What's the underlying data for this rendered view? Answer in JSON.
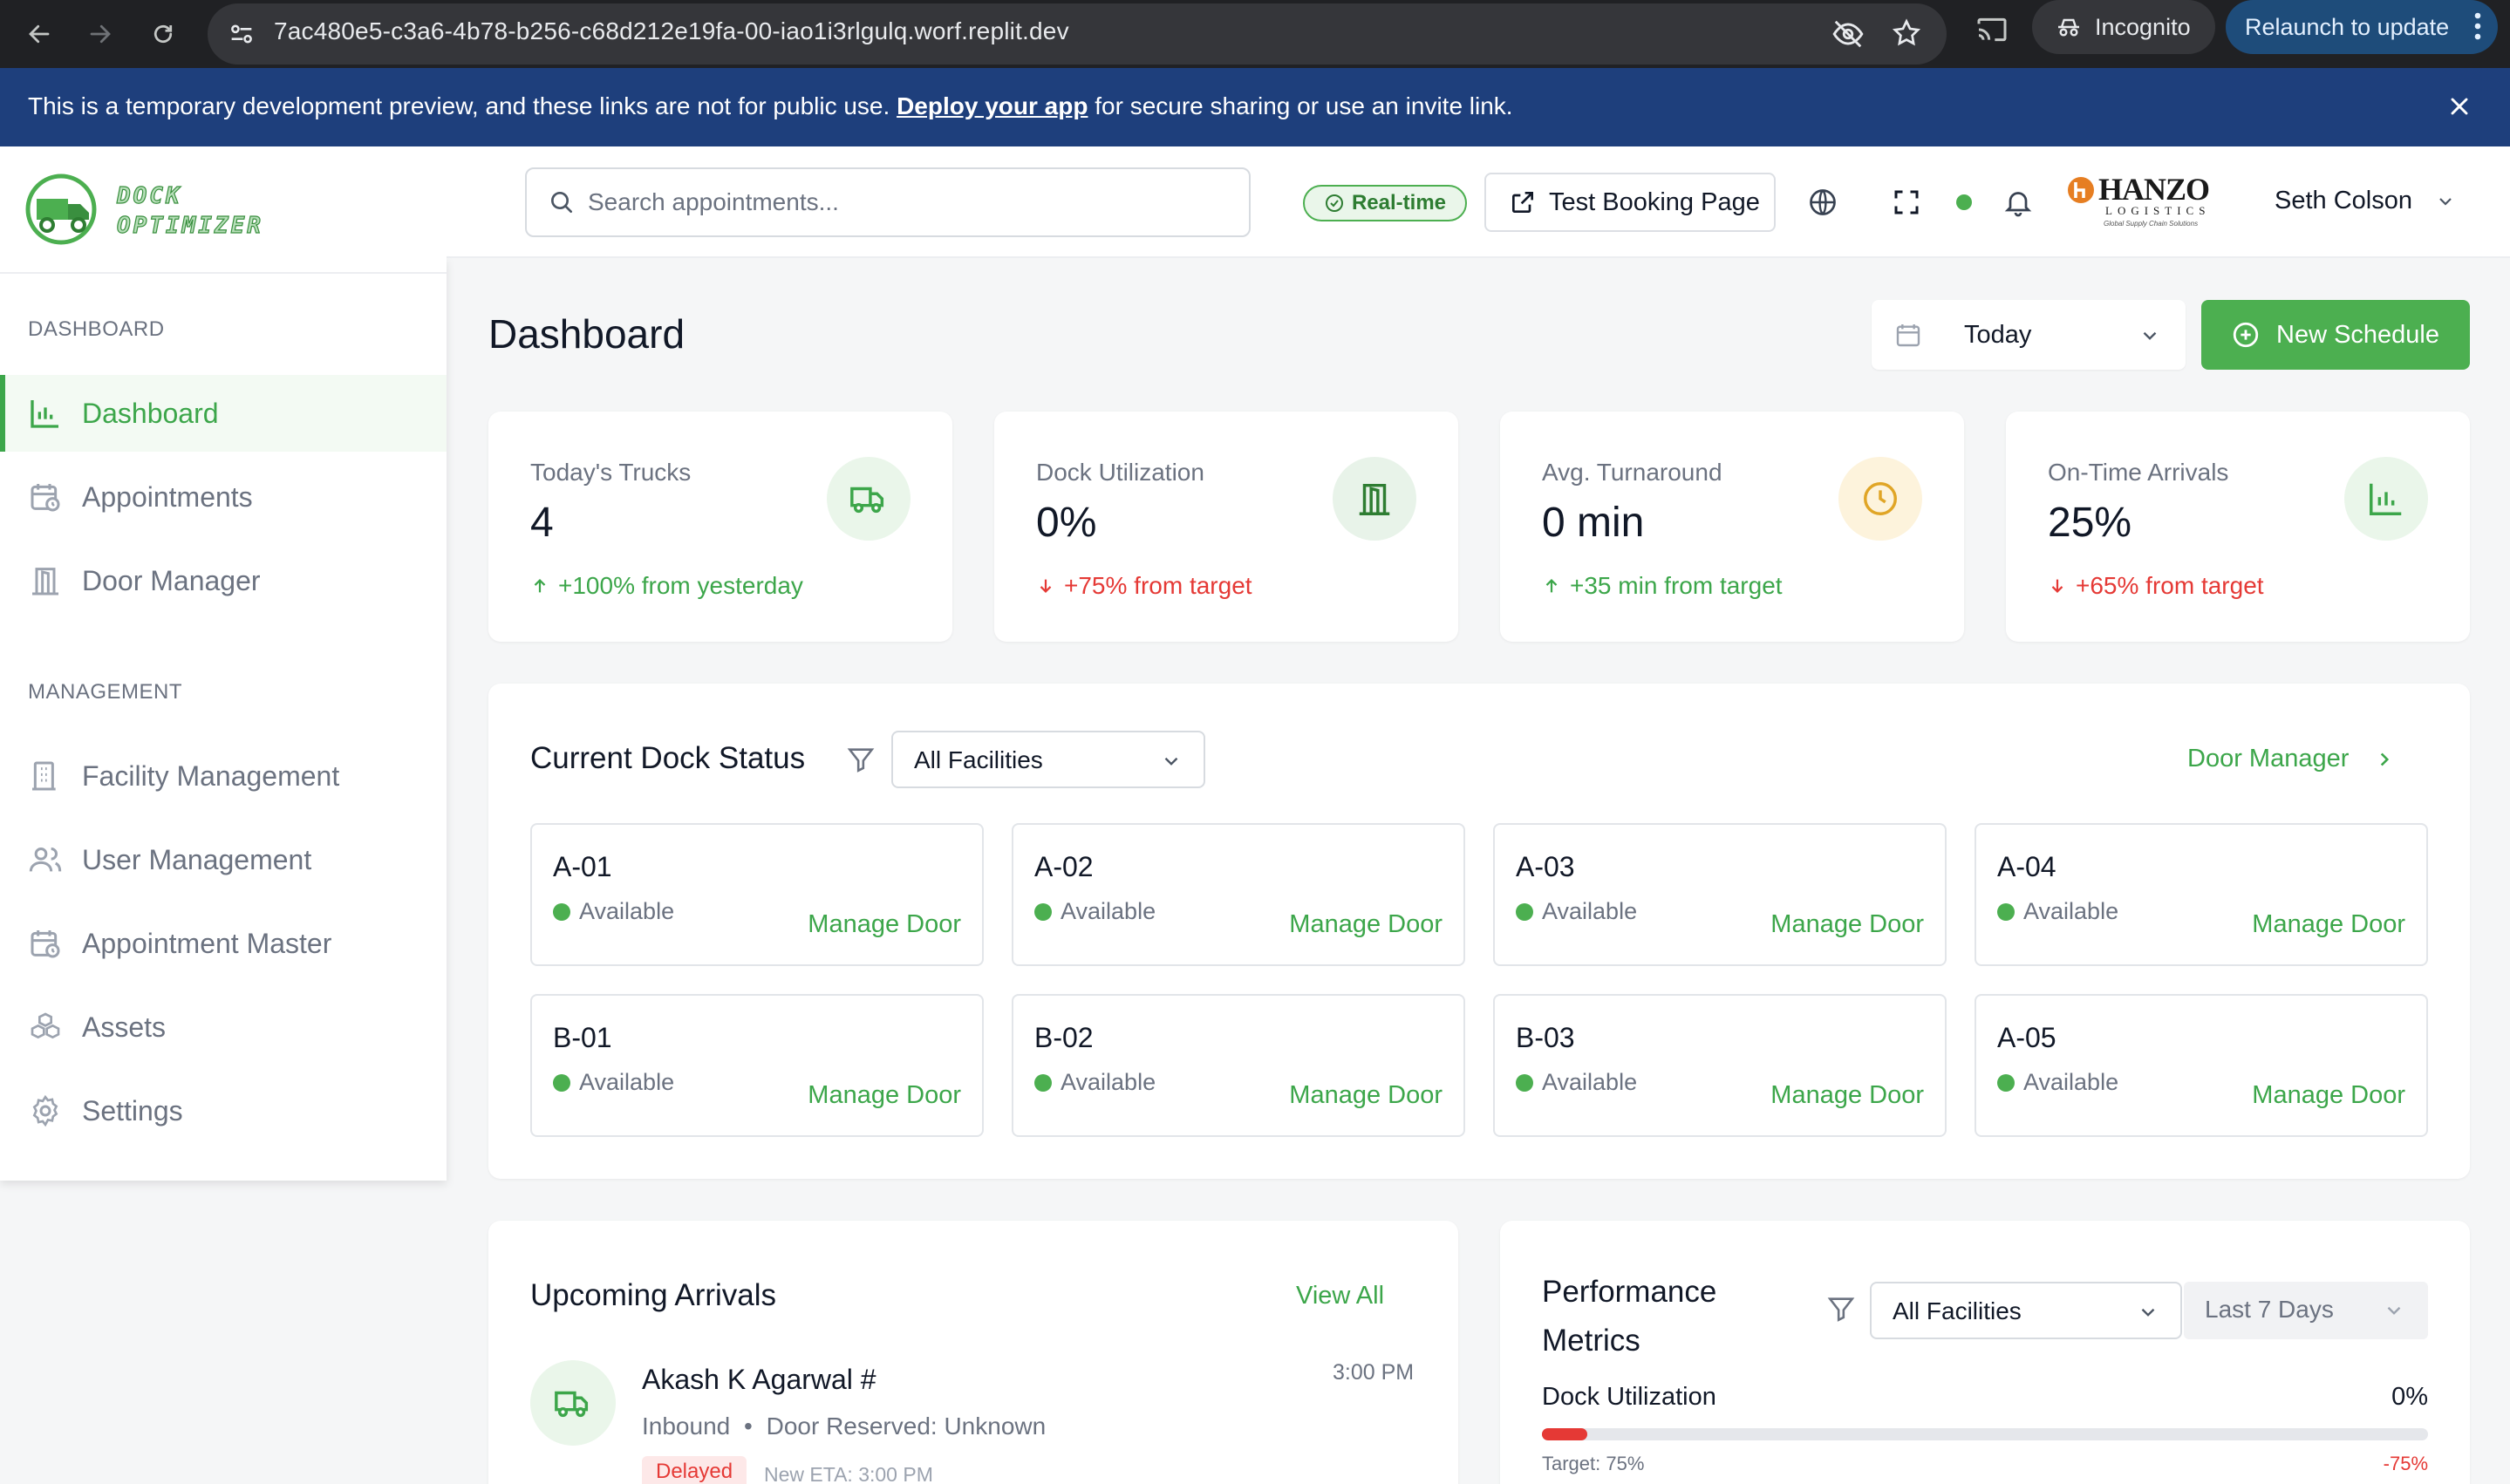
{
  "browser": {
    "url": "7ac480e5-c3a6-4b78-b256-c68d212e19fa-00-iao1i3rlgulq.worf.replit.dev",
    "incognito_label": "Incognito",
    "relaunch_label": "Relaunch to update"
  },
  "banner": {
    "text_before": "This is a temporary development preview, and these links are not for public use.",
    "link": "Deploy your app",
    "text_after": "for secure sharing or use an invite link."
  },
  "logo": {
    "line1": "DOCK",
    "line2": "OPTIMIZER"
  },
  "header": {
    "search_placeholder": "Search appointments...",
    "realtime_label": "Real-time",
    "test_booking_label": "Test Booking Page",
    "company_logo": {
      "name": "HANZO",
      "sub": "LOGISTICS",
      "tagline": "Global Supply Chain Solutions"
    },
    "user_name": "Seth Colson"
  },
  "sidebar": {
    "sections": [
      {
        "label": "DASHBOARD",
        "items": [
          {
            "label": "Dashboard",
            "icon": "bar-chart-icon",
            "active": true
          },
          {
            "label": "Appointments",
            "icon": "calendar-clock-icon"
          },
          {
            "label": "Door Manager",
            "icon": "door-icon"
          }
        ]
      },
      {
        "label": "MANAGEMENT",
        "items": [
          {
            "label": "Facility Management",
            "icon": "building-icon"
          },
          {
            "label": "User Management",
            "icon": "users-icon"
          },
          {
            "label": "Appointment Master",
            "icon": "calendar-clock-icon"
          },
          {
            "label": "Assets",
            "icon": "boxes-icon"
          },
          {
            "label": "Settings",
            "icon": "gear-icon"
          }
        ]
      }
    ]
  },
  "main": {
    "title": "Dashboard",
    "date_filter": "Today",
    "new_schedule_label": "New Schedule",
    "stats": [
      {
        "label": "Today's Trucks",
        "value": "4",
        "delta": "+100% from yesterday",
        "trend": "up",
        "icon": "truck-icon",
        "icon_color": "#3ca64a",
        "icon_bg": "#eaf6ea"
      },
      {
        "label": "Dock Utilization",
        "value": "0%",
        "delta": "+75% from target",
        "trend": "down",
        "icon": "door-icon",
        "icon_color": "#2e7d32",
        "icon_bg": "#e8f3e9"
      },
      {
        "label": "Avg. Turnaround",
        "value": "0 min",
        "delta": "+35 min from target",
        "trend": "up",
        "icon": "clock-icon",
        "icon_color": "#e0a526",
        "icon_bg": "#fdf3dc"
      },
      {
        "label": "On-Time Arrivals",
        "value": "25%",
        "delta": "+65% from target",
        "trend": "down",
        "icon": "bar-chart-icon",
        "icon_color": "#3ca64a",
        "icon_bg": "#eaf6ea"
      }
    ],
    "dock_status": {
      "title": "Current Dock Status",
      "facility_filter": "All Facilities",
      "door_manager_link": "Door Manager",
      "manage_label": "Manage Door",
      "doors": [
        {
          "name": "A-01",
          "status": "Available"
        },
        {
          "name": "A-02",
          "status": "Available"
        },
        {
          "name": "A-03",
          "status": "Available"
        },
        {
          "name": "A-04",
          "status": "Available"
        },
        {
          "name": "B-01",
          "status": "Available"
        },
        {
          "name": "B-02",
          "status": "Available"
        },
        {
          "name": "B-03",
          "status": "Available"
        },
        {
          "name": "A-05",
          "status": "Available"
        }
      ]
    },
    "arrivals": {
      "title": "Upcoming Arrivals",
      "view_all": "View All",
      "items": [
        {
          "name": "Akash K Agarwal #",
          "time": "3:00 PM",
          "type": "Inbound",
          "door": "Door Reserved: Unknown",
          "badge": "Delayed",
          "eta": "New ETA: 3:00 PM"
        }
      ]
    },
    "performance": {
      "title_line1": "Performance",
      "title_line2": "Metrics",
      "facility_filter": "All Facilities",
      "range_filter": "Last 7 Days",
      "metrics": [
        {
          "label": "Dock Utilization",
          "value": "0%",
          "fraction": 0.0,
          "target": "Target: 75%",
          "diff": "-75%"
        }
      ]
    }
  },
  "colors": {
    "brand_green": "#4caf50",
    "banner_blue": "#1e3f7c",
    "danger": "#e53935"
  }
}
